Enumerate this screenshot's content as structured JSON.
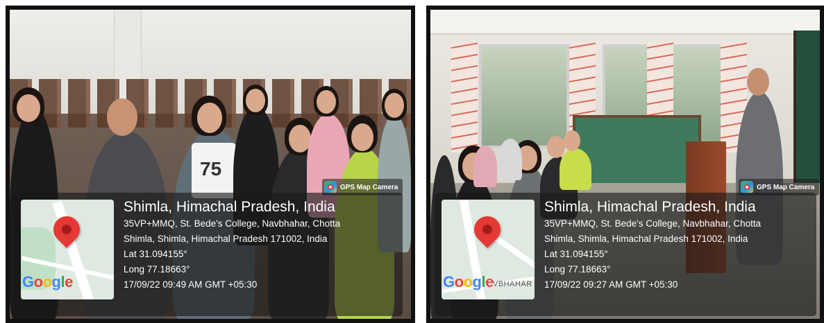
{
  "photos": [
    {
      "gps_badge": "GPS Map Camera",
      "location_title": "Shimla, Himachal Pradesh, India",
      "address_line1": "35VP+MMQ, St. Bede's College, Navbhahar, Chotta",
      "address_line2": "Shimla, Shimla, Himachal Pradesh 171002, India",
      "latitude": "Lat 31.094155°",
      "longitude": "Long 77.18663°",
      "timestamp": "17/09/22 09:49 AM GMT +05:30",
      "map_label": ""
    },
    {
      "gps_badge": "GPS Map Camera",
      "location_title": "Shimla, Himachal Pradesh, India",
      "address_line1": "35VP+MMQ, St. Bede's College, Navbhahar, Chotta",
      "address_line2": "Shimla, Shimla, Himachal Pradesh 171002, India",
      "latitude": "Lat 31.094155°",
      "longitude": "Long 77.18663°",
      "timestamp": "17/09/22 09:27 AM GMT +05:30",
      "map_label": "VBHAHAR"
    }
  ],
  "map_brand": [
    "G",
    "o",
    "o",
    "g",
    "l",
    "e"
  ],
  "shirt_text": "75",
  "colors": {
    "pin": "#e53935",
    "overlay": "rgba(25,25,25,0.62)",
    "board": "#3f7a5c"
  },
  "icons": {
    "map_pin": "map-pin-icon",
    "gps_app": "gps-camera-icon"
  }
}
